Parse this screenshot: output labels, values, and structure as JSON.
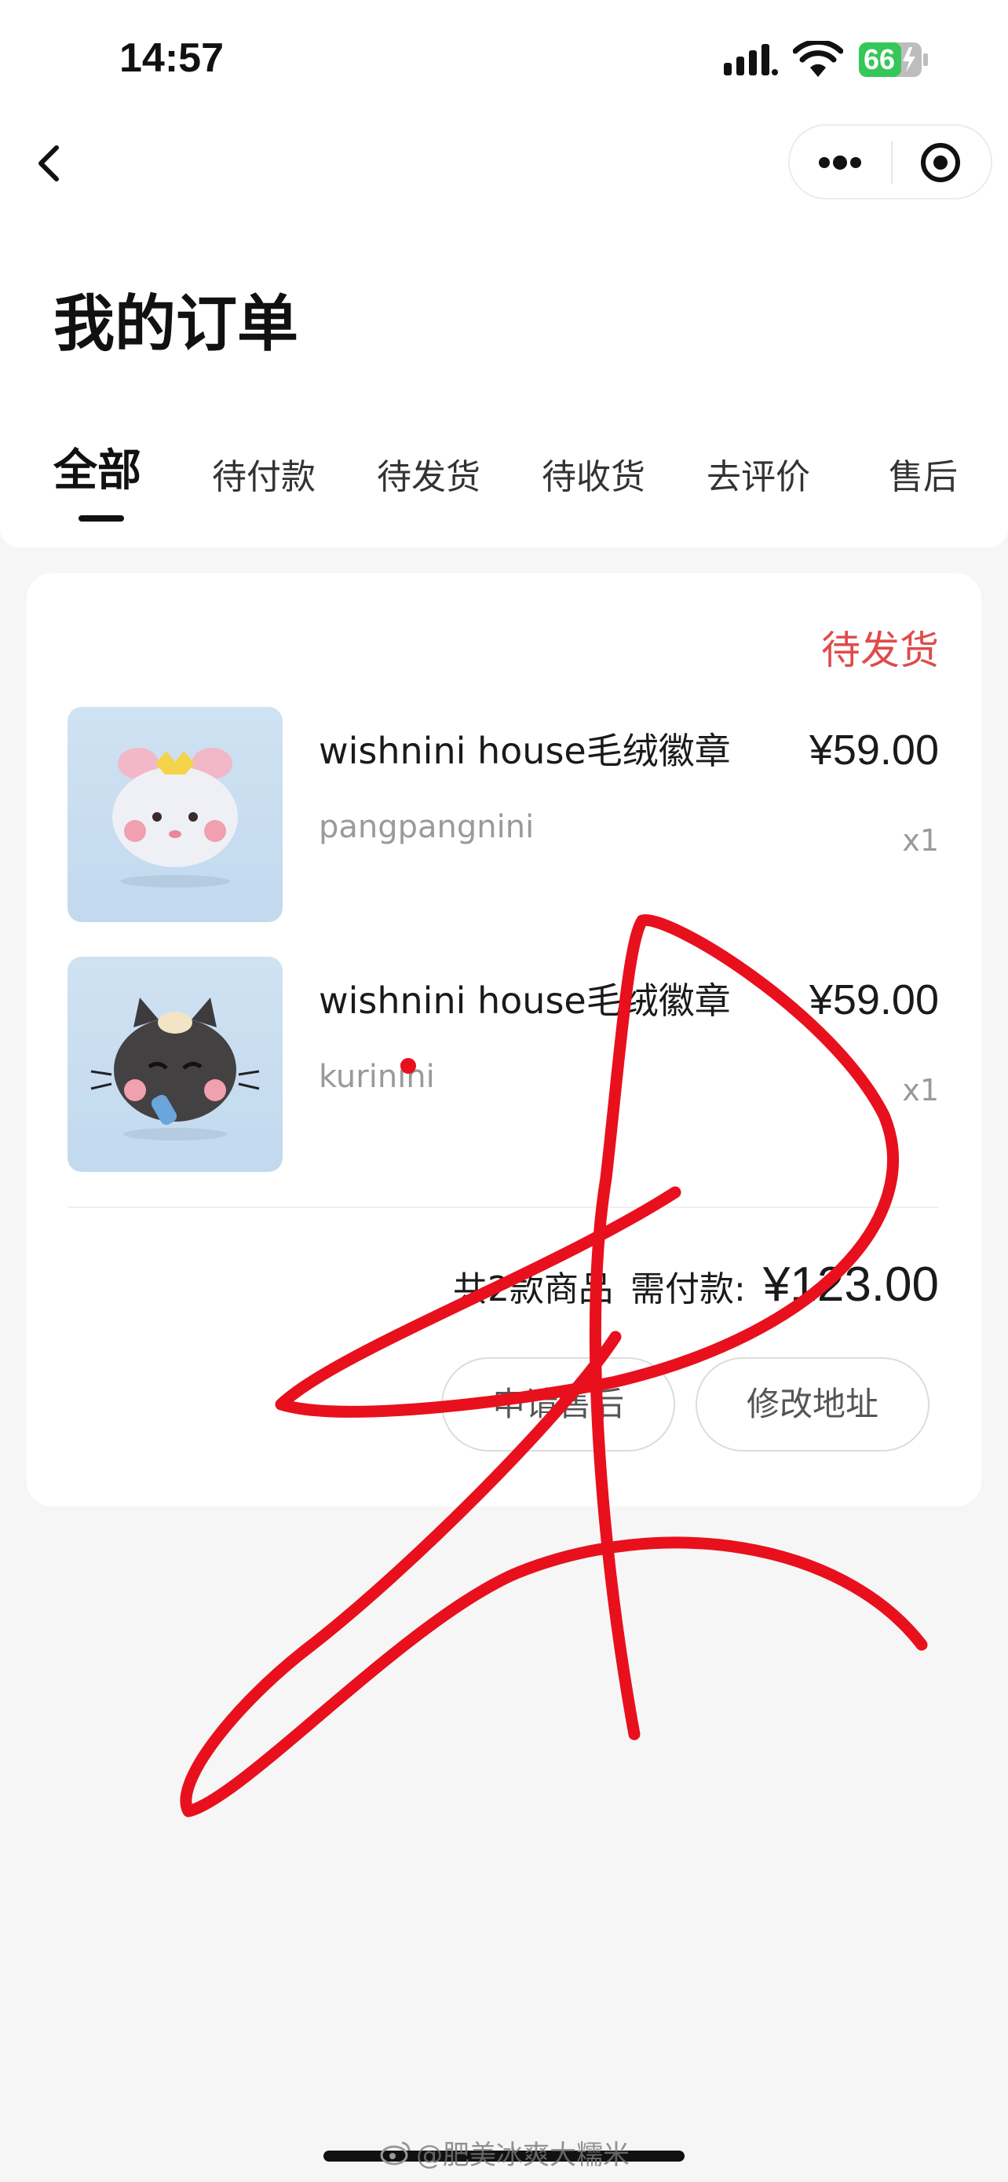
{
  "status_bar": {
    "time": "14:57",
    "battery": "66"
  },
  "header": {
    "title": "我的订单"
  },
  "tabs": [
    {
      "label": "全部",
      "active": true
    },
    {
      "label": "待付款",
      "active": false
    },
    {
      "label": "待发货",
      "active": false
    },
    {
      "label": "待收货",
      "active": false
    },
    {
      "label": "去评价",
      "active": false
    },
    {
      "label": "售后",
      "active": false
    }
  ],
  "order": {
    "status": "待发货",
    "items": [
      {
        "name": "wishnini house毛绒徽章",
        "variant": "pangpangnini",
        "price": "¥59.00",
        "qty": "x1"
      },
      {
        "name": "wishnini house毛绒徽章",
        "variant": "kurinini",
        "price": "¥59.00",
        "qty": "x1"
      }
    ],
    "count_label": "共2款商品",
    "due_label": "需付款:",
    "total": "¥123.00",
    "buttons": {
      "after_sale": "申请售后",
      "edit_address": "修改地址"
    }
  },
  "watermark": "@肥美冰爽大糯米",
  "colors": {
    "status_red": "#e04b4b",
    "scribble_red": "#e8101c",
    "battery_green": "#35c759"
  }
}
